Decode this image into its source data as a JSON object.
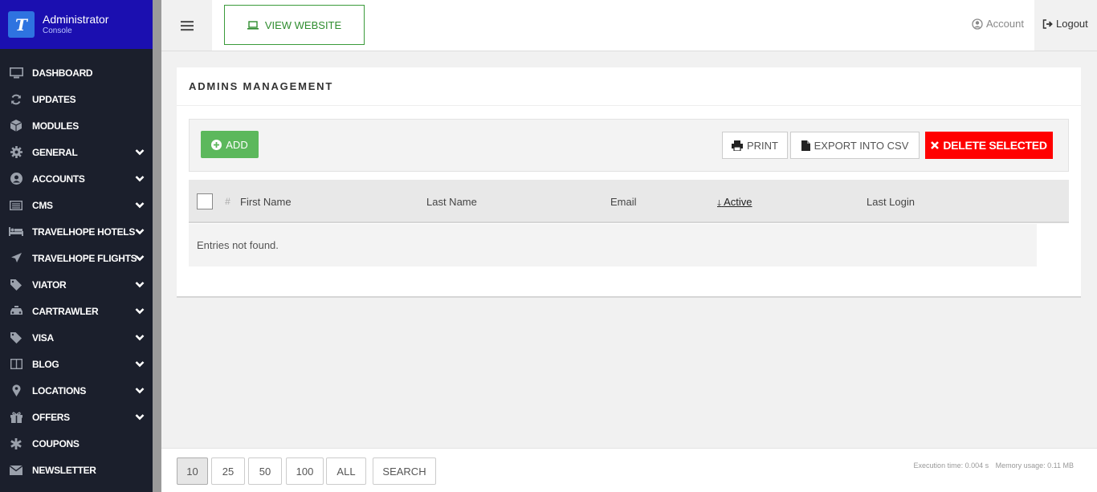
{
  "brand": {
    "title": "Administrator",
    "subtitle": "Console",
    "logo_icon": "travel-logo-icon"
  },
  "sidebar": {
    "items": [
      {
        "label": "DASHBOARD",
        "icon": "monitor-icon",
        "has_submenu": false
      },
      {
        "label": "UPDATES",
        "icon": "refresh-icon",
        "has_submenu": false
      },
      {
        "label": "MODULES",
        "icon": "cube-icon",
        "has_submenu": false
      },
      {
        "label": "GENERAL",
        "icon": "gear-icon",
        "has_submenu": true
      },
      {
        "label": "ACCOUNTS",
        "icon": "user-circle-icon",
        "has_submenu": true
      },
      {
        "label": "CMS",
        "icon": "list-box-icon",
        "has_submenu": true
      },
      {
        "label": "TRAVELHOPE HOTELS",
        "icon": "bed-icon",
        "has_submenu": true
      },
      {
        "label": "TRAVELHOPE FLIGHTS",
        "icon": "plane-icon",
        "has_submenu": true
      },
      {
        "label": "VIATOR",
        "icon": "tag-icon",
        "has_submenu": true
      },
      {
        "label": "CARTRAWLER",
        "icon": "taxi-icon",
        "has_submenu": true
      },
      {
        "label": "VISA",
        "icon": "tag-icon",
        "has_submenu": true
      },
      {
        "label": "BLOG",
        "icon": "columns-icon",
        "has_submenu": true
      },
      {
        "label": "LOCATIONS",
        "icon": "map-marker-icon",
        "has_submenu": true
      },
      {
        "label": "OFFERS",
        "icon": "gift-icon",
        "has_submenu": true
      },
      {
        "label": "COUPONS",
        "icon": "asterisk-icon",
        "has_submenu": false
      },
      {
        "label": "NEWSLETTER",
        "icon": "envelope-icon",
        "has_submenu": false
      }
    ]
  },
  "header": {
    "view_website": "VIEW WEBSITE",
    "account": "Account",
    "logout": "Logout"
  },
  "panel": {
    "title": "ADMINS MANAGEMENT",
    "add": "ADD",
    "print": "PRINT",
    "export_csv": "EXPORT INTO CSV",
    "delete_selected": "DELETE SELECTED"
  },
  "table": {
    "columns": {
      "hash": "#",
      "first_name": "First Name",
      "last_name": "Last Name",
      "email": "Email",
      "active": "Active",
      "last_login": "Last Login"
    },
    "empty_message": "Entries not found."
  },
  "footer": {
    "page_sizes": [
      "10",
      "25",
      "50",
      "100",
      "ALL"
    ],
    "selected_page_size": "10",
    "search": "SEARCH",
    "execution_time": "Execution time: 0.004 s",
    "memory_usage": "Memory usage: 0.11 MB"
  },
  "colors": {
    "sidebar_bg": "#1b1f2c",
    "brand_bg": "#1b0fb0",
    "add_green": "#5cb85c",
    "delete_red": "#ff0000",
    "view_website_green": "#2f8d2f"
  }
}
